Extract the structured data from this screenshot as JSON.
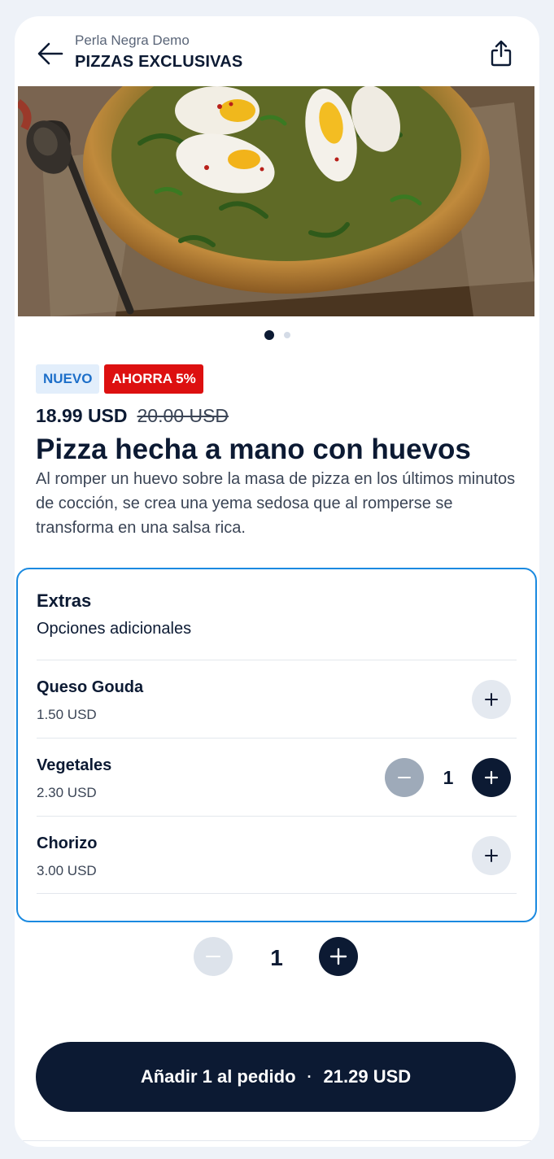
{
  "header": {
    "subtitle": "Perla Negra Demo",
    "title": "PIZZAS EXCLUSIVAS",
    "back_icon": "arrow-left-icon",
    "share_icon": "share-icon"
  },
  "carousel": {
    "total": 2,
    "active": 1
  },
  "badges": {
    "new": "NUEVO",
    "save": "AHORRA 5%"
  },
  "product": {
    "price": "18.99 USD",
    "old_price": "20.00 USD",
    "title": "Pizza hecha a mano con huevos",
    "description": "Al romper un huevo sobre la masa de pizza en los últimos minutos de cocción, se crea una yema sedosa que al romperse se transforma en una salsa rica."
  },
  "extras": {
    "title": "Extras",
    "subtitle": "Opciones adicionales",
    "items": [
      {
        "name": "Queso Gouda",
        "price": "1.50 USD",
        "quantity": 0
      },
      {
        "name": "Vegetales",
        "price": "2.30 USD",
        "quantity": "1"
      },
      {
        "name": "Chorizo",
        "price": "3.00 USD",
        "quantity": 0
      }
    ]
  },
  "order": {
    "quantity": "1",
    "add_label": "Añadir 1 al pedido",
    "separator": "·",
    "total": "21.29 USD"
  },
  "colors": {
    "primary": "#0c1a33",
    "accent_border": "#1b8ae0",
    "badge_new_bg": "#e2eefb",
    "badge_new_text": "#1d6fc9",
    "badge_save_bg": "#dd1010"
  }
}
